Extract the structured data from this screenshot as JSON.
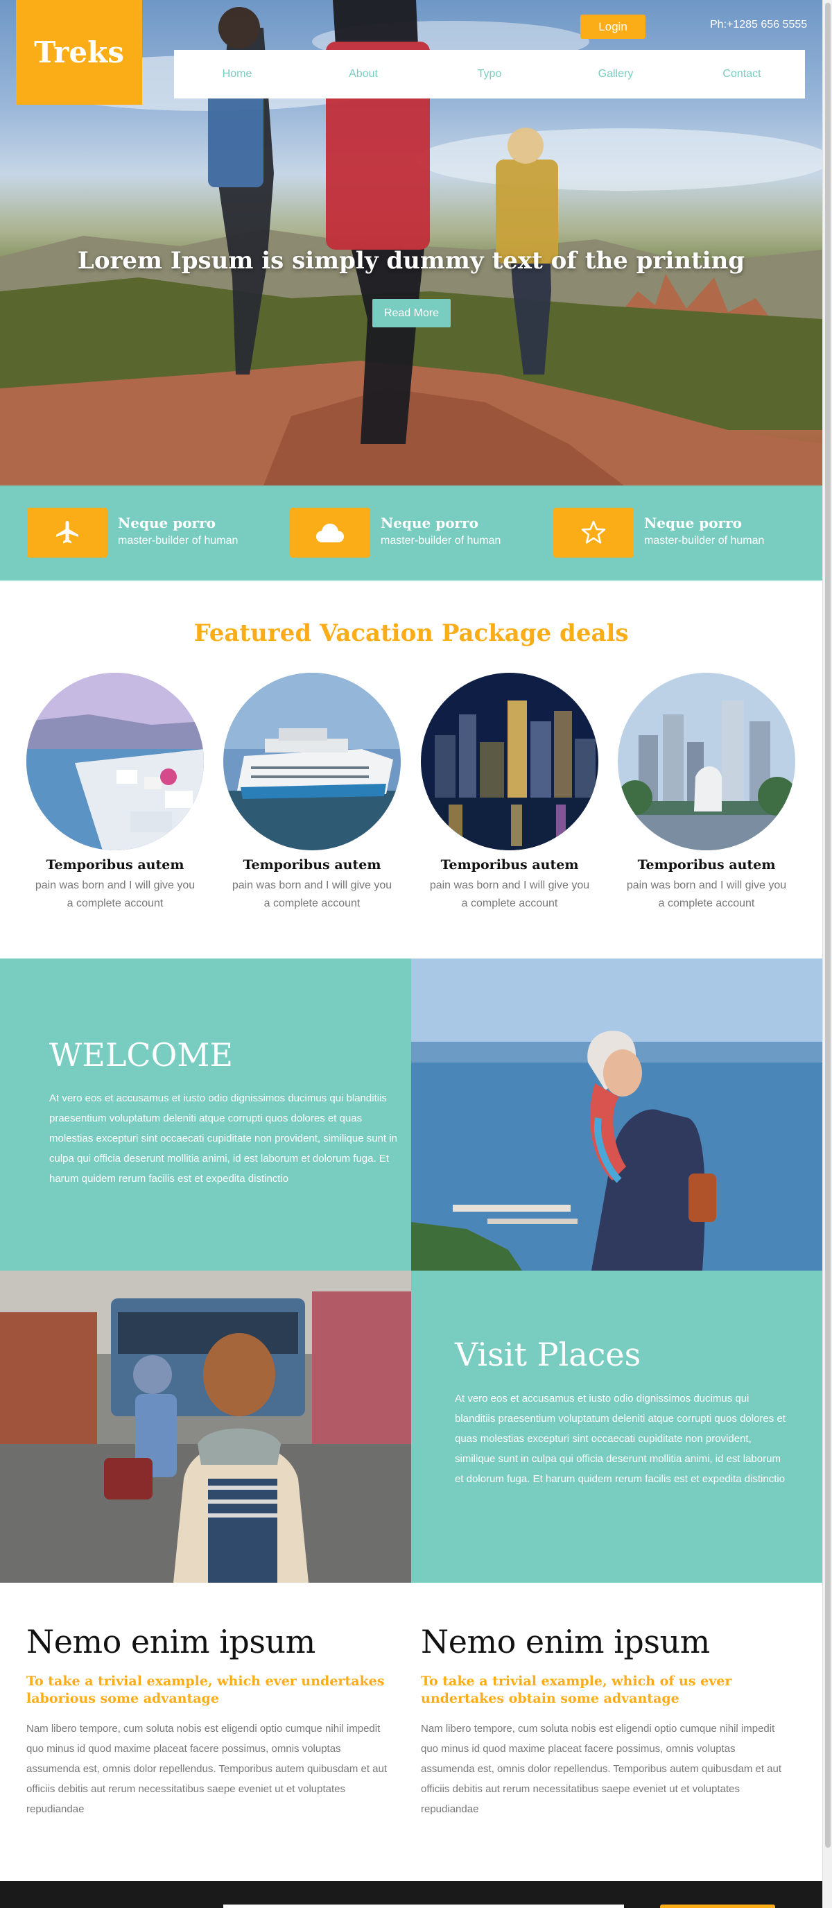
{
  "brand": {
    "logo_text": "Treks"
  },
  "header": {
    "login_label": "Login",
    "phone": "Ph:+1285 656 5555",
    "nav": [
      "Home",
      "About",
      "Typo",
      "Gallery",
      "Contact"
    ]
  },
  "hero": {
    "title": "Lorem Ipsum is simply dummy text of the printing",
    "cta_label": "Read More"
  },
  "features": [
    {
      "icon": "airplane-icon",
      "title": "Neque porro",
      "subtitle": "master-builder of human"
    },
    {
      "icon": "cloud-icon",
      "title": "Neque porro",
      "subtitle": "master-builder of human"
    },
    {
      "icon": "star-icon",
      "title": "Neque porro",
      "subtitle": "master-builder of human"
    }
  ],
  "featured": {
    "heading": "Featured Vacation Package deals",
    "packages": [
      {
        "title": "Temporibus autem",
        "desc": "pain was born and I will give you a complete account"
      },
      {
        "title": "Temporibus autem",
        "desc": "pain was born and I will give you a complete account"
      },
      {
        "title": "Temporibus autem",
        "desc": "pain was born and I will give you a complete account"
      },
      {
        "title": "Temporibus autem",
        "desc": "pain was born and I will give you a complete account"
      }
    ]
  },
  "welcome": {
    "heading": "WELCOME",
    "text": "At vero eos et accusamus et iusto odio dignissimos ducimus qui blanditiis praesentium voluptatum deleniti atque corrupti quos dolores et quas molestias excepturi sint occaecati cupiditate non provident, similique sunt in culpa qui officia deserunt mollitia animi, id est laborum et dolorum fuga. Et harum quidem rerum facilis est et expedita distinctio"
  },
  "visit": {
    "heading": "Visit Places",
    "text": "At vero eos et accusamus et iusto odio dignissimos ducimus qui blanditiis praesentium voluptatum deleniti atque corrupti quos dolores et quas molestias excepturi sint occaecati cupiditate non provident, similique sunt in culpa qui officia deserunt mollitia animi, id est laborum et dolorum fuga. Et harum quidem rerum facilis est et expedita distinctio"
  },
  "nemo": [
    {
      "heading": "Nemo enim ipsum",
      "subheading": "To take a trivial example, which ever undertakes laborious some advantage",
      "text": "Nam libero tempore, cum soluta nobis est eligendi optio cumque nihil impedit quo minus id quod maxime placeat facere possimus, omnis voluptas assumenda est, omnis dolor repellendus. Temporibus autem quibusdam et aut officiis debitis aut rerum necessitatibus saepe eveniet ut et voluptates repudiandae"
    },
    {
      "heading": "Nemo enim ipsum",
      "subheading": "To take a trivial example, which of us ever undertakes obtain some advantage",
      "text": "Nam libero tempore, cum soluta nobis est eligendi optio cumque nihil impedit quo minus id quod maxime placeat facere possimus, omnis voluptas assumenda est, omnis dolor repellendus. Temporibus autem quibusdam et aut officiis debitis aut rerum necessitatibus saepe eveniet ut et voluptates repudiandae"
    }
  ],
  "colors": {
    "accent": "#fbad18",
    "teal": "#79cdc0",
    "footer": "#1a1a1a"
  }
}
